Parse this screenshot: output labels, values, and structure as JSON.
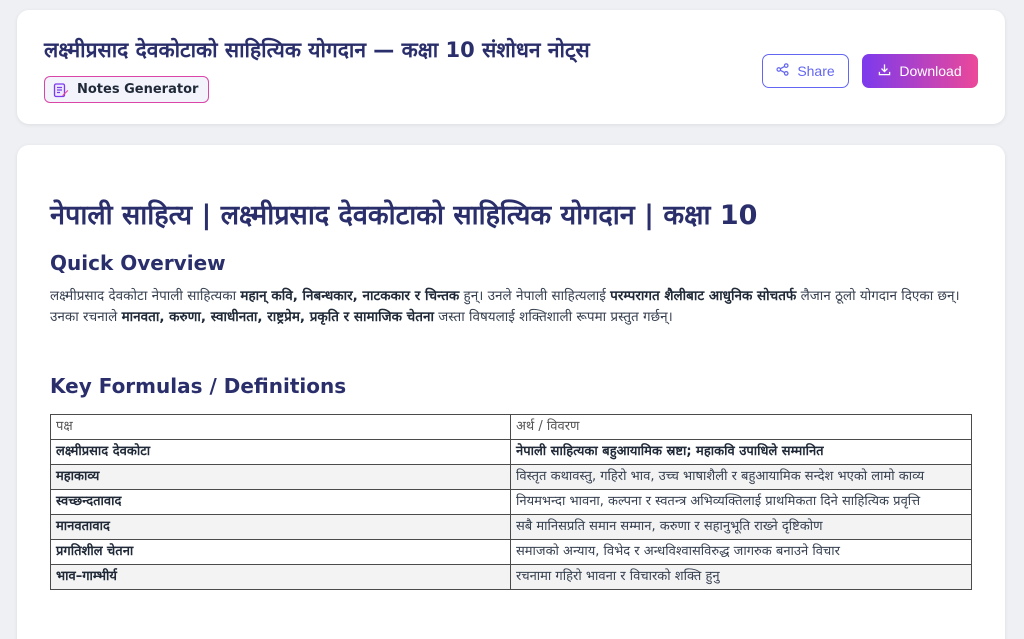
{
  "header": {
    "title": "लक्ष्मीप्रसाद देवकोटाको साहित्यिक योगदान — कक्षा 10 संशोधन नोट्स",
    "badge": "Notes Generator",
    "share_label": "Share",
    "download_label": "Download"
  },
  "doc": {
    "title": "नेपाली साहित्य | लक्ष्मीप्रसाद देवकोटाको साहित्यिक योगदान | कक्षा 10",
    "overview_heading": "Quick Overview",
    "overview": {
      "t1": "लक्ष्मीप्रसाद देवकोटा नेपाली साहित्यका ",
      "b1": "महान् कवि, निबन्धकार, नाटककार र चिन्तक",
      "t2": " हुन्। उनले नेपाली साहित्यलाई ",
      "b2": "परम्परागत शैलीबाट आधुनिक सोचतर्फ",
      "t3": " लैजान ठूलो योगदान दिएका छन्। उनका रचनाले ",
      "b3": "मानवता, करुणा, स्वाधीनता, राष्ट्रप्रेम, प्रकृति र सामाजिक चेतना",
      "t4": " जस्ता विषयलाई शक्तिशाली रूपमा प्रस्तुत गर्छन्।"
    },
    "defs_heading": "Key Formulas / Definitions",
    "table": {
      "headers": [
        "पक्ष",
        "अर्थ / विवरण"
      ],
      "rows": [
        [
          "लक्ष्मीप्रसाद देवकोटा",
          "नेपाली साहित्यका बहुआयामिक स्रष्टा; महाकवि उपाधिले सम्मानित"
        ],
        [
          "महाकाव्य",
          "विस्तृत कथावस्तु, गहिरो भाव, उच्च भाषाशैली र बहुआयामिक सन्देश भएको लामो काव्य"
        ],
        [
          "स्वच्छन्दतावाद",
          "नियमभन्दा भावना, कल्पना र स्वतन्त्र अभिव्यक्तिलाई प्राथमिकता दिने साहित्यिक प्रवृत्ति"
        ],
        [
          "मानवतावाद",
          "सबै मानिसप्रति समान सम्मान, करुणा र सहानुभूति राख्ने दृष्टिकोण"
        ],
        [
          "प्रगतिशील चेतना",
          "समाजको अन्याय, विभेद र अन्धविश्वासविरुद्ध जागरुक बनाउने विचार"
        ],
        [
          "भाव–गाम्भीर्य",
          "रचनामा गहिरो भावना र विचारको शक्ति हुनु"
        ]
      ]
    }
  },
  "colors": {
    "accent": "#6366f1",
    "gradient_start": "#7c3aed",
    "gradient_end": "#ec4899",
    "heading": "#2a2f6b"
  },
  "icons": {
    "badge": "notes-edit-icon",
    "share": "share-icon",
    "download": "download-icon"
  }
}
